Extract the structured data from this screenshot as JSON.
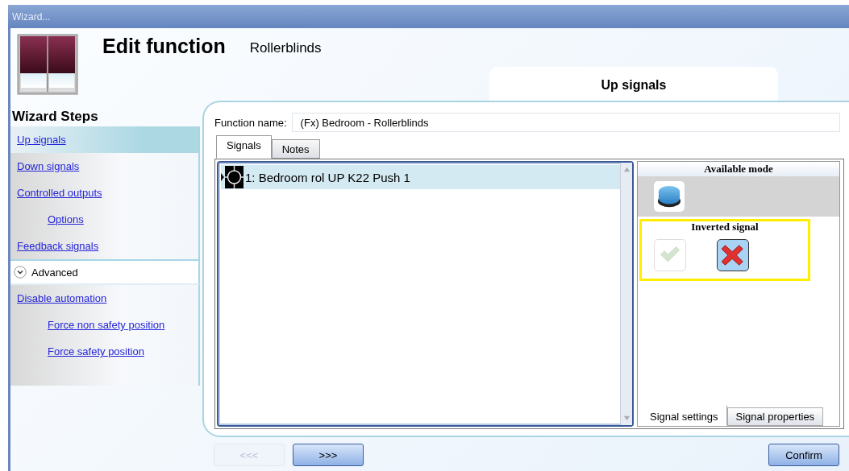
{
  "window": {
    "title": "Wizard..."
  },
  "header": {
    "title": "Edit function",
    "subtitle": "Rollerblinds"
  },
  "step_tab": {
    "label": "Up signals"
  },
  "sidebar": {
    "title": "Wizard Steps",
    "items": [
      {
        "label": "Up signals",
        "selected": true
      },
      {
        "label": "Down signals",
        "selected": false
      },
      {
        "label": "Controlled outputs",
        "selected": false,
        "children": [
          {
            "label": "Options",
            "selected": false
          }
        ]
      },
      {
        "label": "Feedback signals",
        "selected": false
      }
    ],
    "advanced": {
      "label": "Advanced",
      "expanded": true,
      "items": [
        {
          "label": "Disable automation",
          "selected": false,
          "children": [
            {
              "label": "Force non safety position",
              "selected": false
            },
            {
              "label": "Force safety position",
              "selected": false
            }
          ]
        }
      ]
    }
  },
  "function_name": {
    "label": "Function name:",
    "value": "(Fx) Bedroom - Rollerblinds"
  },
  "tabs": [
    {
      "label": "Signals",
      "selected": true
    },
    {
      "label": "Notes",
      "selected": false
    }
  ],
  "signals": [
    {
      "label": "1: Bedroom rol UP K22 Push 1",
      "selected": true
    }
  ],
  "available_mode": {
    "title": "Available mode"
  },
  "inverted_signal": {
    "title": "Inverted signal",
    "highlighted": true,
    "options": [
      {
        "kind": "check",
        "selected": false
      },
      {
        "kind": "cross",
        "selected": true
      }
    ]
  },
  "settings_tabs": [
    {
      "label": "Signal settings",
      "selected": true
    },
    {
      "label": "Signal properties",
      "selected": false
    }
  ],
  "buttons": [
    {
      "label": "<<<",
      "disabled": true
    },
    {
      "label": ">>>",
      "disabled": false
    },
    {
      "label": "Confirm",
      "disabled": false
    }
  ]
}
